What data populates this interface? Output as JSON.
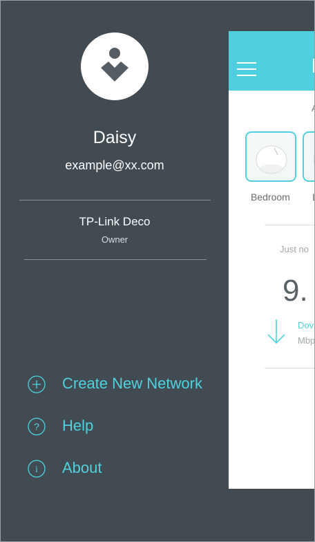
{
  "drawer": {
    "user": {
      "name": "Daisy",
      "email": "example@xx.com"
    },
    "network": {
      "name": "TP-Link Deco",
      "role": "Owner"
    },
    "menu": [
      {
        "label": "Create New Network",
        "icon": "plus-circle-icon"
      },
      {
        "label": "Help",
        "icon": "question-circle-icon"
      },
      {
        "label": "About",
        "icon": "info-circle-icon"
      }
    ]
  },
  "panel": {
    "header_char": "T",
    "top_char": "A",
    "devices": [
      {
        "label": "Bedroom"
      },
      {
        "label": "L"
      }
    ],
    "status_time": "Just no",
    "speed_value": "9.",
    "direction_label": "Dov",
    "unit": "Mbp"
  },
  "colors": {
    "drawer_bg": "#424b51",
    "accent": "#4dd2e0",
    "header_bg": "#4fd0de"
  }
}
